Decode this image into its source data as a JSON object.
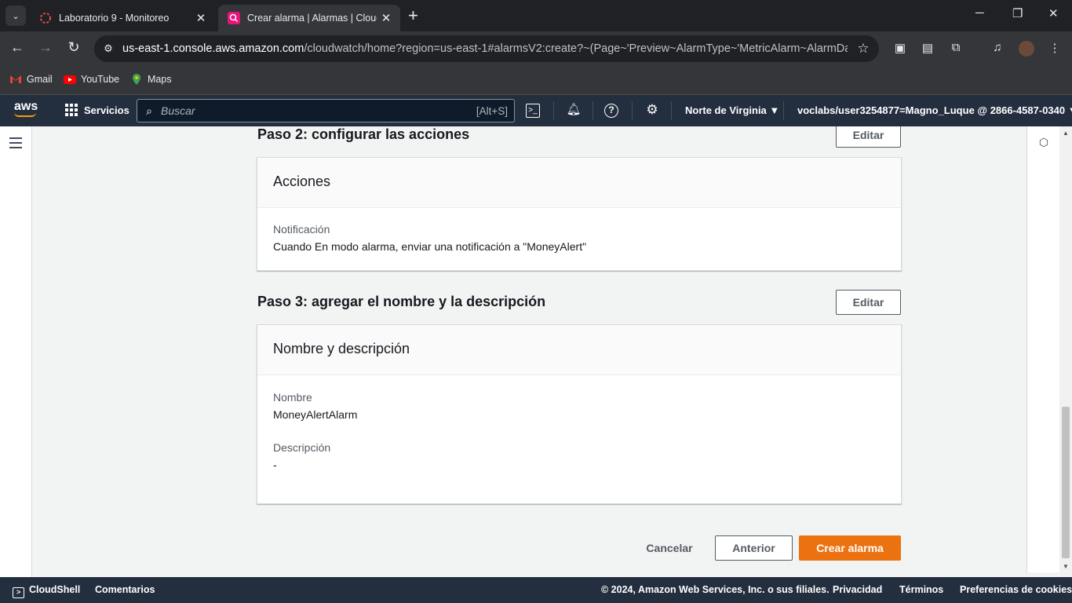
{
  "browser": {
    "tabs": [
      {
        "title": "Laboratorio 9 - Monitoreo",
        "active": false
      },
      {
        "title": "Crear alarma | Alarmas | CloudW",
        "active": true
      }
    ],
    "url_host": "us-east-1.console.aws.amazon.com",
    "url_path": "/cloudwatch/home?region=us-east-1#alarmsV2:create?~(Page~'Preview~AlarmType~'MetricAlarm~AlarmData~...",
    "bookmarks": [
      "Gmail",
      "YouTube",
      "Maps"
    ]
  },
  "aws_nav": {
    "logo": "aws",
    "services_label": "Servicios",
    "search_placeholder": "Buscar",
    "search_shortcut": "[Alt+S]",
    "region": "Norte de Virginia ▼",
    "account": "voclabs/user3254877=Magno_Luque @ 2866-4587-0340 ▼"
  },
  "step2": {
    "heading": "Paso 2: configurar las acciones",
    "edit_label": "Editar",
    "panel_title": "Acciones",
    "notification_label": "Notificación",
    "notification_value": "Cuando En modo alarma, enviar una notificación a \"MoneyAlert\""
  },
  "step3": {
    "heading": "Paso 3: agregar el nombre y la descripción",
    "edit_label": "Editar",
    "panel_title": "Nombre y descripción",
    "name_label": "Nombre",
    "name_value": "MoneyAlertAlarm",
    "description_label": "Descripción",
    "description_value": "-"
  },
  "actions": {
    "cancel": "Cancelar",
    "previous": "Anterior",
    "create": "Crear alarma"
  },
  "footer": {
    "cloudshell": "CloudShell",
    "feedback": "Comentarios",
    "copyright": "© 2024, Amazon Web Services, Inc. o sus filiales.",
    "privacy": "Privacidad",
    "terms": "Términos",
    "cookies": "Preferencias de cookies"
  },
  "colors": {
    "aws_nav_bg": "#232f3e",
    "primary_button": "#ec7211",
    "browser_bg": "#202124"
  }
}
